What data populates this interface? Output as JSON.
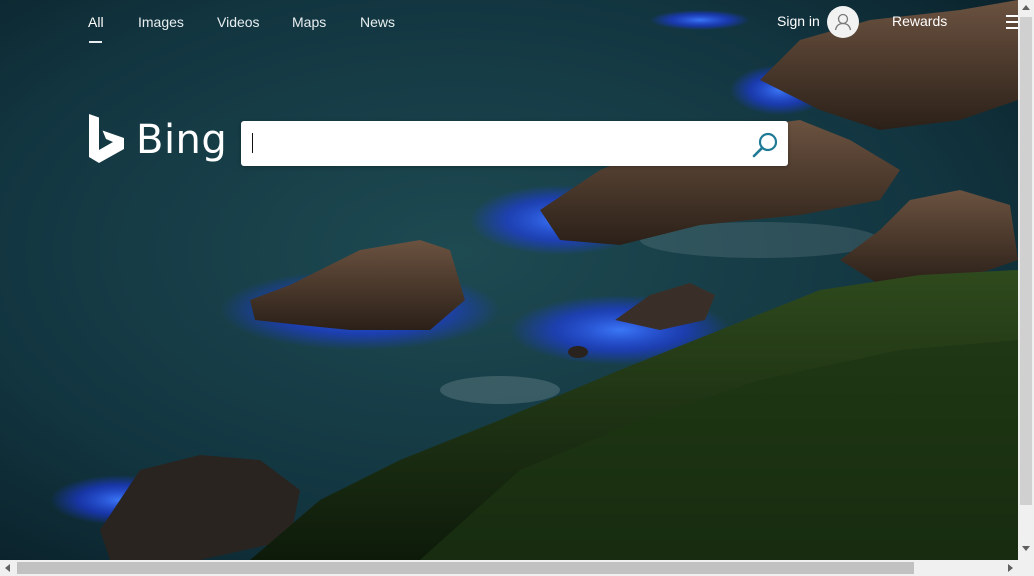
{
  "nav": {
    "scopes": [
      {
        "label": "All",
        "active": true
      },
      {
        "label": "Images",
        "active": false
      },
      {
        "label": "Videos",
        "active": false
      },
      {
        "label": "Maps",
        "active": false
      },
      {
        "label": "News",
        "active": false
      }
    ],
    "sign_in": "Sign in",
    "rewards": "Rewards",
    "avatar_icon": "user-icon",
    "menu_icon": "hamburger-menu-icon"
  },
  "logo": {
    "text": "Bing",
    "icon": "bing-b-logo-icon"
  },
  "search": {
    "value": "",
    "placeholder": "",
    "icon": "search-icon"
  },
  "colors": {
    "background": "#0c2a33",
    "glow": "#2e5cff",
    "text": "#ffffff"
  }
}
